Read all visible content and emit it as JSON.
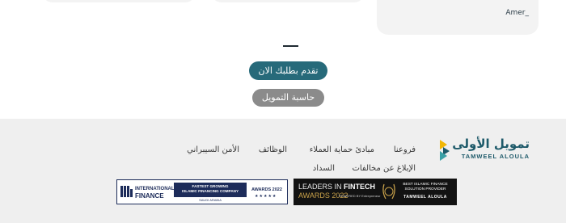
{
  "testimonials": {
    "author": "Amer_"
  },
  "cta": {
    "apply_label": "تقدم بطلبك الان",
    "calculator_label": "حاسبة التمويل"
  },
  "footer": {
    "logo": {
      "arabic_name": "تمويل الأولى",
      "english_name": "TAMWEEL ALOULA"
    },
    "links": {
      "branches": "فروعنا",
      "customer_protection": "مبادئ حماية العملاء",
      "jobs": "الوظائف",
      "cyber_security": "الأمن السيبراني",
      "report_violations": "الإبلاغ عن مخالفات",
      "payment": "السداد"
    },
    "awards": {
      "international_finance": {
        "brand_line1": "INTERNATIONAL",
        "brand_line2": "FINANCE",
        "banner_line1": "FASTEST GROWING",
        "banner_line2": "ISLAMIC FINANCING COMPANY",
        "country": "SAUDI ARABIA",
        "awards_year": "AWARDS 2022",
        "stars": "★★★★★"
      },
      "leaders_in_fintech": {
        "line1_prefix": "LEADERS IN",
        "line1_bold": "FINTECH",
        "line2": "AWARDS 2022",
        "powered_by": "POWERED BY Entrepreneur",
        "badge_text_line1": "BEST ISLAMIC FINANCE",
        "badge_text_line2": "SOLUTION PROVIDER",
        "brand": "TAMWEEL ALOULA"
      }
    }
  },
  "colors": {
    "primary_teal": "#276a7a",
    "secondary_gray": "#8b8b8b",
    "footer_background": "#efefef",
    "logo_yellow": "#f2b705",
    "logo_teal": "#1e5a6a"
  }
}
